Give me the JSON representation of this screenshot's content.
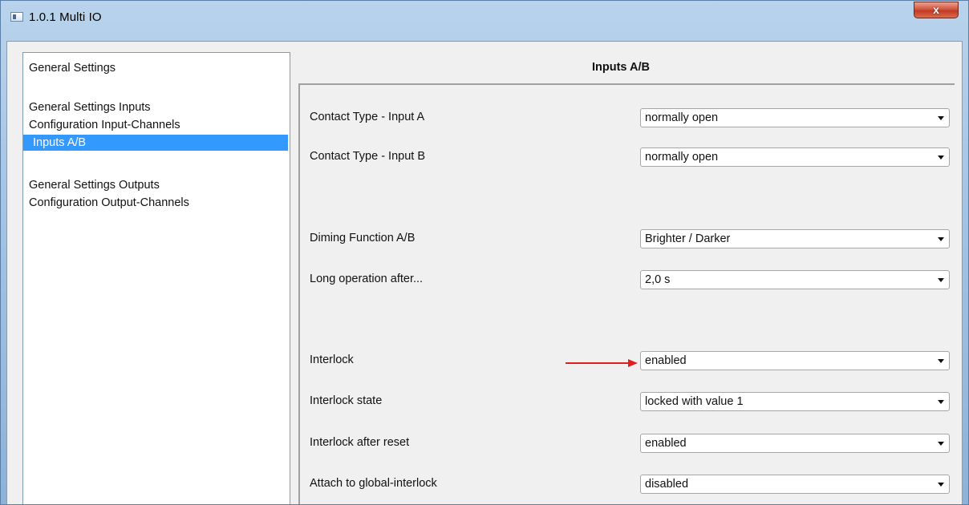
{
  "window": {
    "title": "1.0.1 Multi IO",
    "close_label": "x"
  },
  "sidebar": {
    "items": [
      {
        "label": "General Settings"
      },
      {
        "label": "General Settings Inputs"
      },
      {
        "label": "Configuration Input-Channels"
      },
      {
        "label": "Inputs  A/B"
      },
      {
        "label": "General Settings Outputs"
      },
      {
        "label": "Configuration Output-Channels"
      }
    ],
    "selected": "Inputs  A/B"
  },
  "main": {
    "section_title": "Inputs  A/B",
    "params": [
      {
        "label": "Contact Type - Input A",
        "value": "normally open"
      },
      {
        "label": "Contact Type - Input B",
        "value": "normally open"
      },
      {
        "label": "Diming Function A/B",
        "value": "Brighter / Darker"
      },
      {
        "label": "Long operation after...",
        "value": "2,0 s"
      },
      {
        "label": "Interlock",
        "value": "enabled"
      },
      {
        "label": "Interlock state",
        "value": "locked with value 1"
      },
      {
        "label": "Interlock after reset",
        "value": "enabled"
      },
      {
        "label": "Attach  to global-interlock",
        "value": "disabled"
      }
    ]
  },
  "colors": {
    "selection": "#3399ff",
    "annotation_arrow": "#e02020"
  },
  "icons": {
    "window_icon": "app-window-icon",
    "dropdown": "chevron-down-icon",
    "annotation": "red-arrow-icon"
  }
}
